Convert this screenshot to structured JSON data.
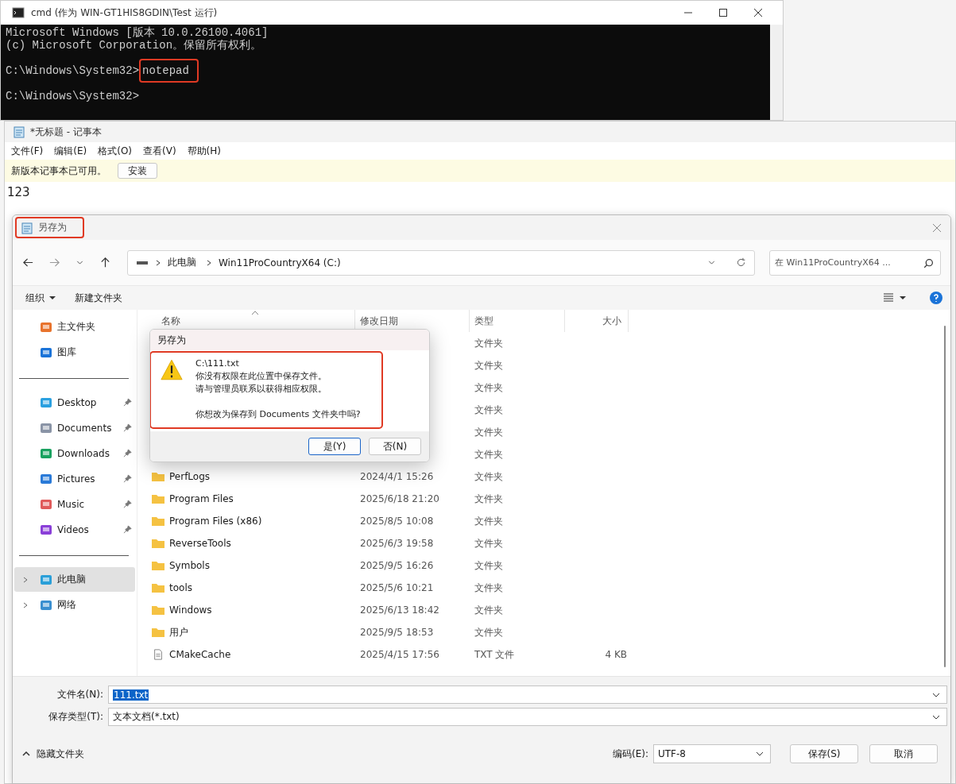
{
  "cmd_window": {
    "title": "cmd (作为 WIN-GT1HIS8GDIN\\Test 运行)",
    "lines": [
      {
        "kind": "text",
        "text": "Microsoft Windows [版本 10.0.26100.4061]"
      },
      {
        "kind": "text",
        "text": "(c) Microsoft Corporation。保留所有权利。"
      },
      {
        "kind": "blank"
      },
      {
        "kind": "prompt",
        "prompt": "C:\\Windows\\System32>",
        "command": "notepad",
        "highlighted": true
      },
      {
        "kind": "blank"
      },
      {
        "kind": "prompt",
        "prompt": "C:\\Windows\\System32>"
      }
    ]
  },
  "notepad": {
    "title": "*无标题 - 记事本",
    "menu": [
      "文件(F)",
      "编辑(E)",
      "格式(O)",
      "查看(V)",
      "帮助(H)"
    ],
    "banner": {
      "text": "新版本记事本已可用。",
      "button": "安装"
    },
    "content": "123"
  },
  "save_dialog": {
    "title": "另存为",
    "title_highlighted": true,
    "breadcrumb": [
      "此电脑",
      "Win11ProCountryX64 (C:)"
    ],
    "search": {
      "placeholder": "在 Win11ProCountryX64 ..."
    },
    "toolbar": [
      {
        "label": "组织",
        "dropdown": true
      },
      {
        "label": "新建文件夹",
        "dropdown": false
      }
    ],
    "sidebar": [
      [
        {
          "label": "主文件夹",
          "pinned": false,
          "expandable": false,
          "selected": false
        },
        {
          "label": "图库",
          "pinned": false,
          "expandable": false,
          "selected": false
        }
      ],
      [
        {
          "label": "Desktop",
          "pinned": true,
          "expandable": false,
          "selected": false
        },
        {
          "label": "Documents",
          "pinned": true,
          "expandable": false,
          "selected": false
        },
        {
          "label": "Downloads",
          "pinned": true,
          "expandable": false,
          "selected": false
        },
        {
          "label": "Pictures",
          "pinned": true,
          "expandable": false,
          "selected": false
        },
        {
          "label": "Music",
          "pinned": true,
          "expandable": false,
          "selected": false
        },
        {
          "label": "Videos",
          "pinned": true,
          "expandable": false,
          "selected": false
        }
      ],
      [
        {
          "label": "此电脑",
          "pinned": false,
          "expandable": true,
          "selected": true
        },
        {
          "label": "网络",
          "pinned": false,
          "expandable": true,
          "selected": false
        }
      ]
    ],
    "columns": [
      "名称",
      "修改日期",
      "类型",
      "大小"
    ],
    "rows": [
      {
        "type": "文件夹"
      },
      {
        "type": "文件夹"
      },
      {
        "type": "文件夹"
      },
      {
        "type": "文件夹"
      },
      {
        "type": "文件夹"
      },
      {
        "type": "文件夹"
      },
      {
        "kind": "folder",
        "name": "PerfLogs",
        "date": "2024/4/1 15:26",
        "type": "文件夹"
      },
      {
        "kind": "folder",
        "name": "Program Files",
        "date": "2025/6/18 21:20",
        "type": "文件夹"
      },
      {
        "kind": "folder",
        "name": "Program Files (x86)",
        "date": "2025/8/5 10:08",
        "type": "文件夹"
      },
      {
        "kind": "folder",
        "name": "ReverseTools",
        "date": "2025/6/3 19:58",
        "type": "文件夹"
      },
      {
        "kind": "folder",
        "name": "Symbols",
        "date": "2025/9/5 16:26",
        "type": "文件夹"
      },
      {
        "kind": "folder",
        "name": "tools",
        "date": "2025/5/6 10:21",
        "type": "文件夹"
      },
      {
        "kind": "folder",
        "name": "Windows",
        "date": "2025/6/13 18:42",
        "type": "文件夹"
      },
      {
        "kind": "folder",
        "name": "用户",
        "date": "2025/9/5 18:53",
        "type": "文件夹"
      },
      {
        "kind": "file",
        "name": "CMakeCache",
        "date": "2025/4/15 17:56",
        "type": "TXT 文件",
        "size": "4 KB"
      }
    ],
    "filename": {
      "label": "文件名(N):",
      "value": "111.txt",
      "text_selected": true
    },
    "filetype": {
      "label": "保存类型(T):",
      "value": "文本文档(*.txt)"
    },
    "hide_folders": "隐藏文件夹",
    "encoding": {
      "label": "编码(E):",
      "value": "UTF-8"
    },
    "buttons": [
      "保存(S)",
      "取消"
    ],
    "message_box": {
      "title": "另存为",
      "highlighted": true,
      "paragraphs": [
        [
          "C:\\111.txt",
          "你没有权限在此位置中保存文件。",
          "请与管理员联系以获得相应权限。"
        ],
        [
          "你想改为保存到 Documents 文件夹中吗?"
        ]
      ],
      "buttons": [
        {
          "label": "是(Y)",
          "default": true
        },
        {
          "label": "否(N)",
          "default": false
        }
      ]
    }
  }
}
